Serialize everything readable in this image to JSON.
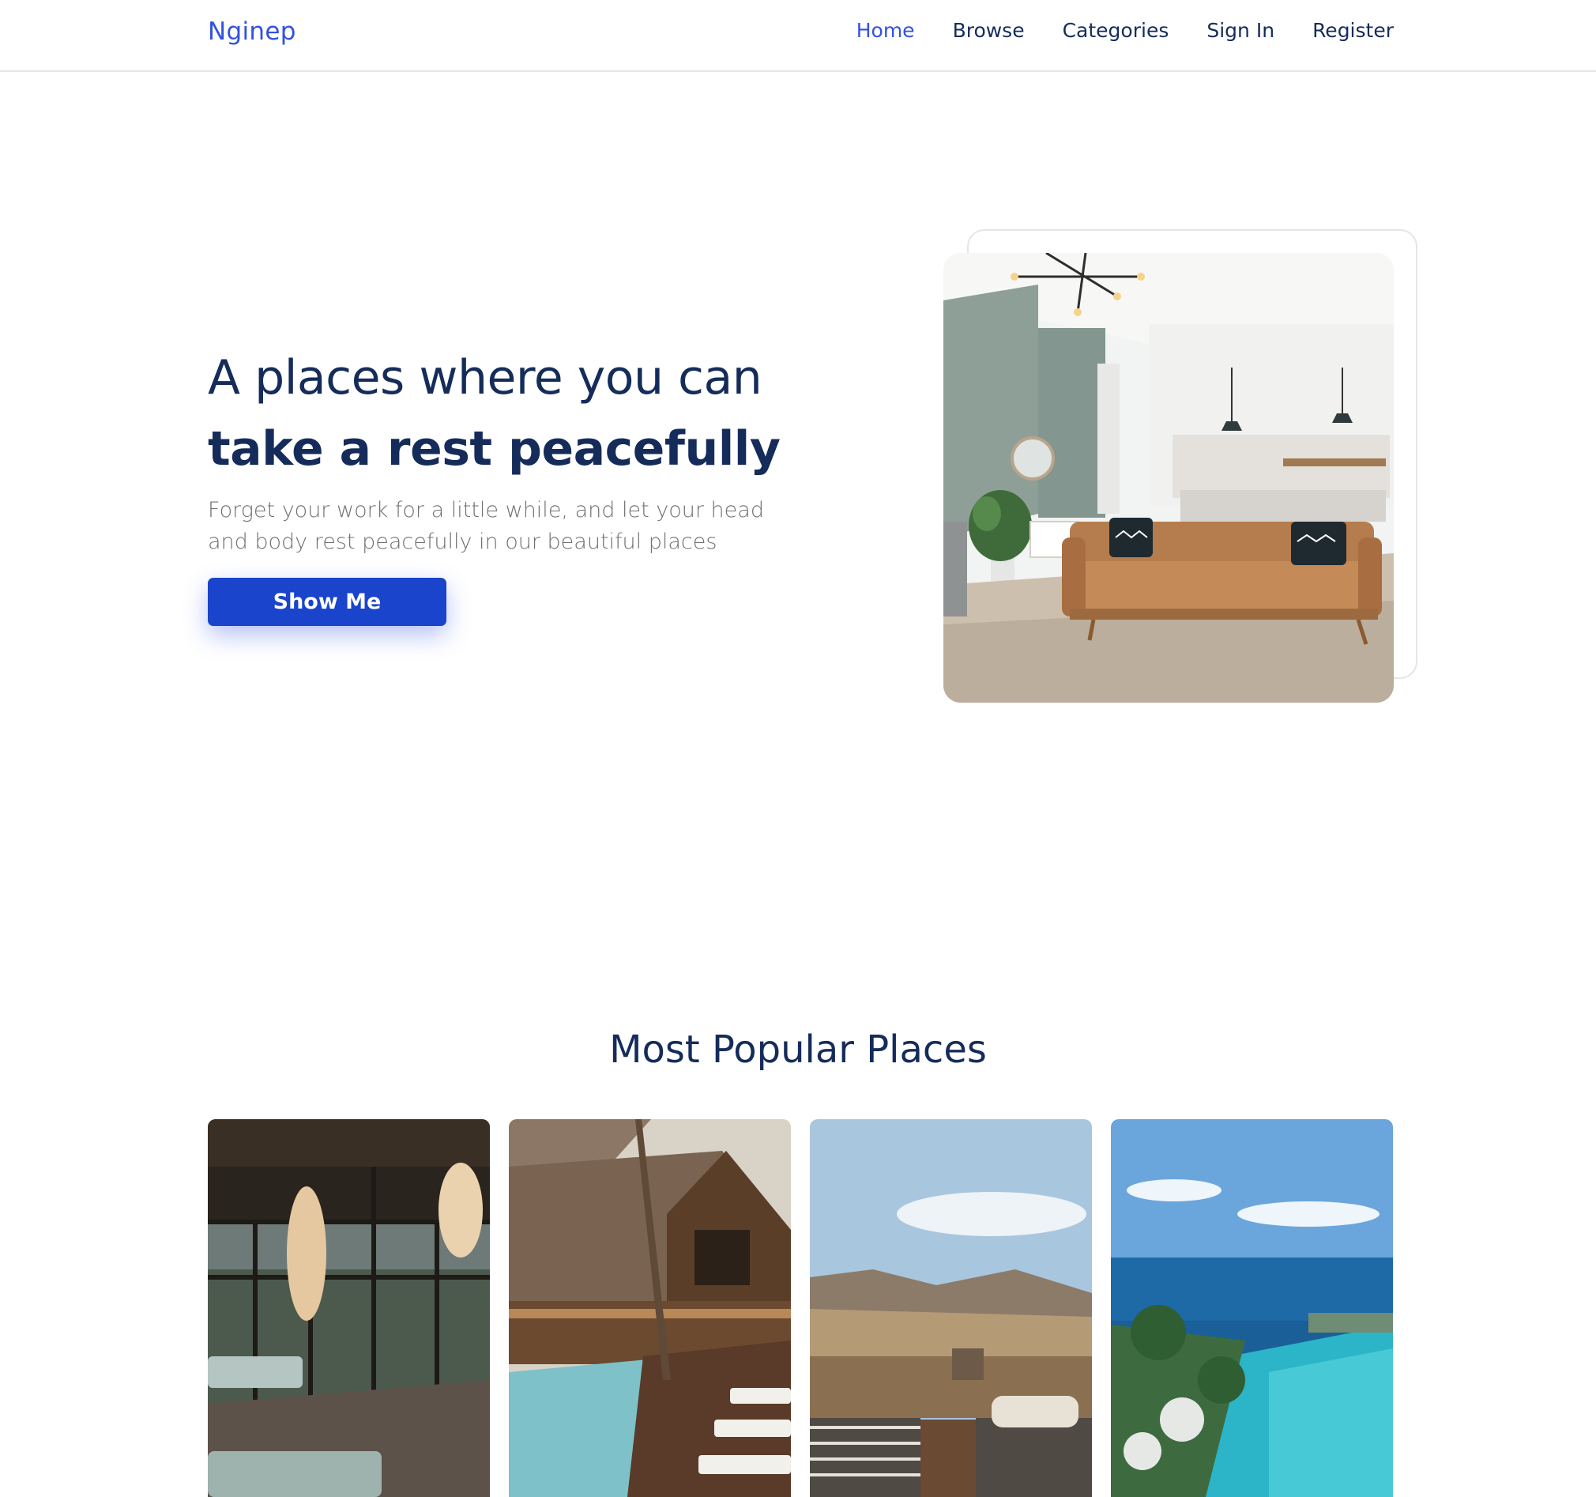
{
  "brand": "Nginep",
  "nav": {
    "home": "Home",
    "browse": "Browse",
    "categories": "Categories",
    "sign_in": "Sign In",
    "register": "Register"
  },
  "hero": {
    "title_line1": "A places where you can",
    "title_line2": "take a rest peacefully",
    "subtitle": "Forget your work for a little while, and let your head and body rest peacefully in our beautiful places",
    "cta": "Show Me"
  },
  "popular": {
    "title": "Most Popular Places"
  },
  "colors": {
    "brand": "#3252df",
    "heading": "#152c5b",
    "muted": "#707070",
    "button": "#1a44cc"
  }
}
